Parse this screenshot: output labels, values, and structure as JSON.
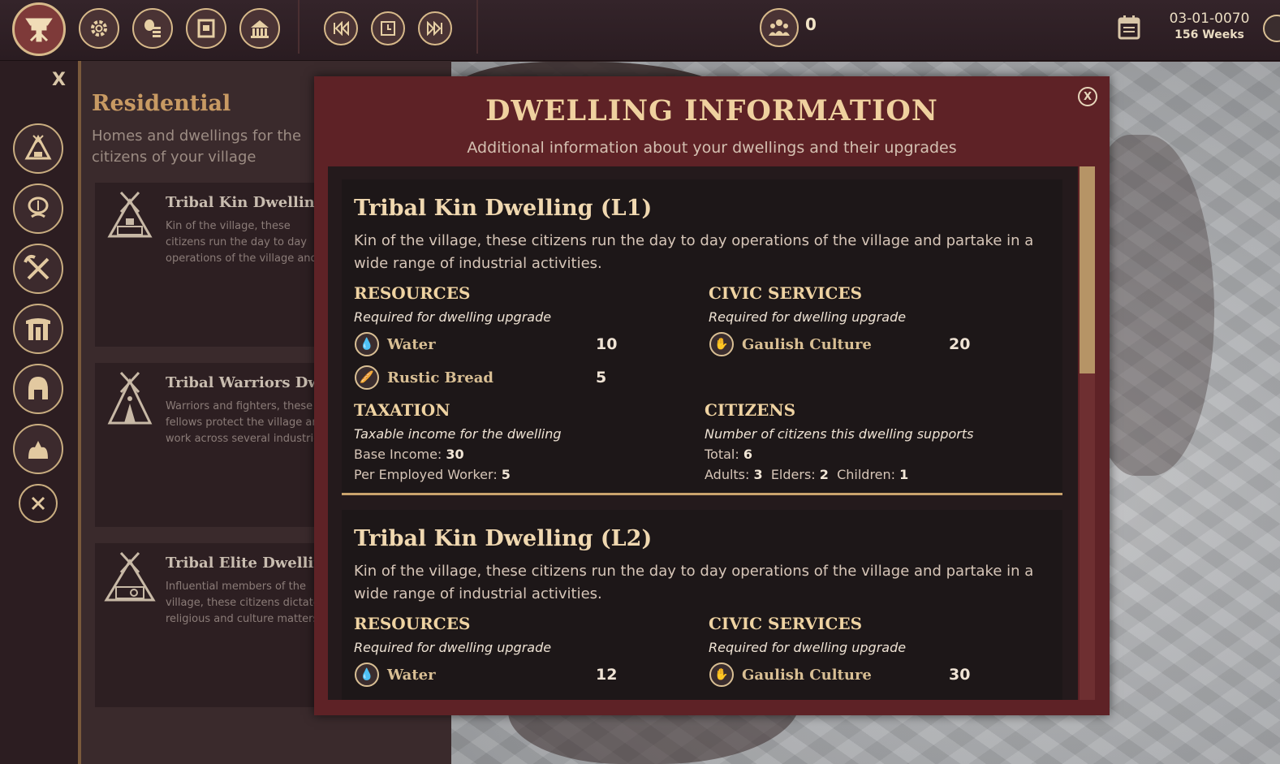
{
  "topbar": {
    "population_count": "0",
    "date": "03-01-0070",
    "weeks": "156 Weeks",
    "icons": [
      "menu-shield-icon",
      "settings-gear-icon",
      "economy-coins-icon",
      "scroll-icon",
      "city-hall-icon",
      "rewind-icon",
      "pause-icon",
      "fast-forward-icon",
      "population-icon",
      "calendar-icon"
    ]
  },
  "rail": {
    "close_label": "X",
    "buttons": [
      "residential-tent-icon",
      "food-icon",
      "industry-tools-icon",
      "monument-icon",
      "military-helmet-icon",
      "culture-icon",
      "close-circle-icon"
    ]
  },
  "residential": {
    "title": "Residential",
    "subtitle": "Homes and dwellings for the citizens of your village",
    "cards": [
      {
        "title": "Tribal Kin Dwelling",
        "desc": "Kin of the village, these citizens run the day to day operations of the village and partake in a wide range of industrial activities."
      },
      {
        "title": "Tribal Warriors Dwelling",
        "desc": "Warriors and fighters, these fellows protect the village and work across several industries to create robust goods."
      },
      {
        "title": "Tribal Elite Dwelling",
        "desc": "Influential members of the village, these citizens dictate religious and culture matters and manage key industries for the betterment of the village."
      }
    ]
  },
  "modal": {
    "close_label": "X",
    "title": "DWELLING INFORMATION",
    "subtitle": "Additional information about your dwellings and their upgrades",
    "dwellings": [
      {
        "title": "Tribal Kin Dwelling (L1)",
        "desc": "Kin of the village, these citizens run the day to day operations of the village and partake in a wide range of industrial activities.",
        "resources_h": "RESOURCES",
        "resources_s": "Required for dwelling upgrade",
        "resources": [
          {
            "name": "Water",
            "value": "10"
          },
          {
            "name": "Rustic Bread",
            "value": "5"
          }
        ],
        "civic_h": "CIVIC SERVICES",
        "civic_s": "Required for dwelling upgrade",
        "civic": [
          {
            "name": "Gaulish Culture",
            "value": "20"
          }
        ],
        "tax_h": "TAXATION",
        "tax_s": "Taxable income for the dwelling",
        "base_income_label": "Base Income:",
        "base_income": "30",
        "per_worker_label": "Per Employed Worker:",
        "per_worker": "5",
        "citizens_h": "CITIZENS",
        "citizens_s": "Number of citizens this dwelling supports",
        "total_label": "Total:",
        "total": "6",
        "adults_label": "Adults:",
        "adults": "3",
        "elders_label": "Elders:",
        "elders": "2",
        "children_label": "Children:",
        "children": "1"
      },
      {
        "title": "Tribal Kin Dwelling (L2)",
        "desc": "Kin of the village, these citizens run the day to day operations of the village and partake in a wide range of industrial activities.",
        "resources_h": "RESOURCES",
        "resources_s": "Required for dwelling upgrade",
        "resources": [
          {
            "name": "Water",
            "value": "12"
          }
        ],
        "civic_h": "CIVIC SERVICES",
        "civic_s": "Required for dwelling upgrade",
        "civic": [
          {
            "name": "Gaulish Culture",
            "value": "30"
          }
        ]
      }
    ]
  }
}
